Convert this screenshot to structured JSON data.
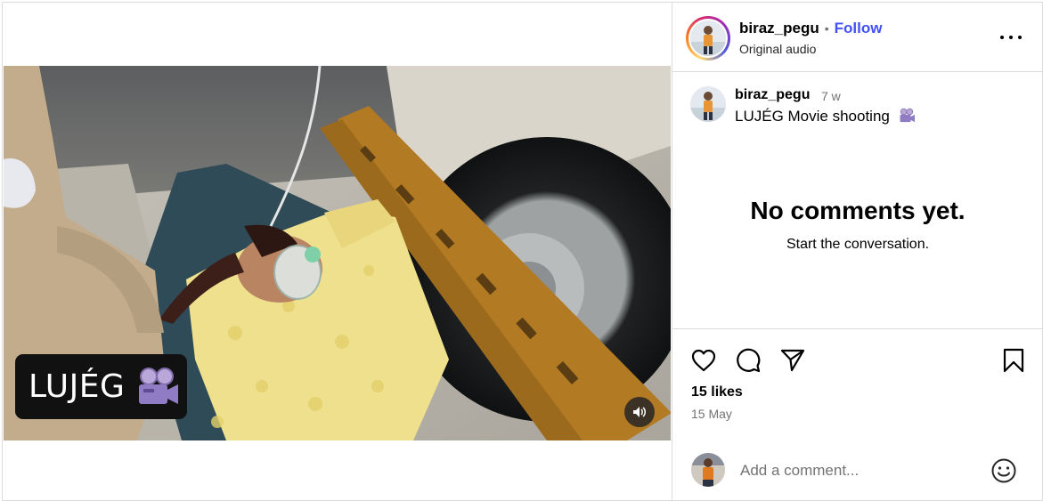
{
  "post": {
    "username": "biraz_pegu",
    "separator": "•",
    "follow_label": "Follow",
    "audio_label": "Original audio",
    "more_label": "More options"
  },
  "video": {
    "watermark_text": "LUJÉG",
    "watermark_icon": "movie-camera-icon",
    "mute_icon": "speaker-icon"
  },
  "caption": {
    "username": "biraz_pegu",
    "time": "7 w",
    "text": "LUJÉG Movie shooting",
    "emoji_icon": "movie-camera-icon"
  },
  "comments": {
    "empty_title": "No comments yet.",
    "empty_subtitle": "Start the conversation."
  },
  "actions": {
    "like_icon": "heart-icon",
    "comment_icon": "comment-icon",
    "share_icon": "send-icon",
    "save_icon": "bookmark-icon"
  },
  "stats": {
    "likes": "15 likes",
    "date": "15 May"
  },
  "comment_box": {
    "placeholder": "Add a comment...",
    "emoji_icon": "smiley-icon"
  },
  "colors": {
    "follow_blue": "#4150f7",
    "muted_text": "#737373",
    "divider": "#dbdbdb"
  }
}
